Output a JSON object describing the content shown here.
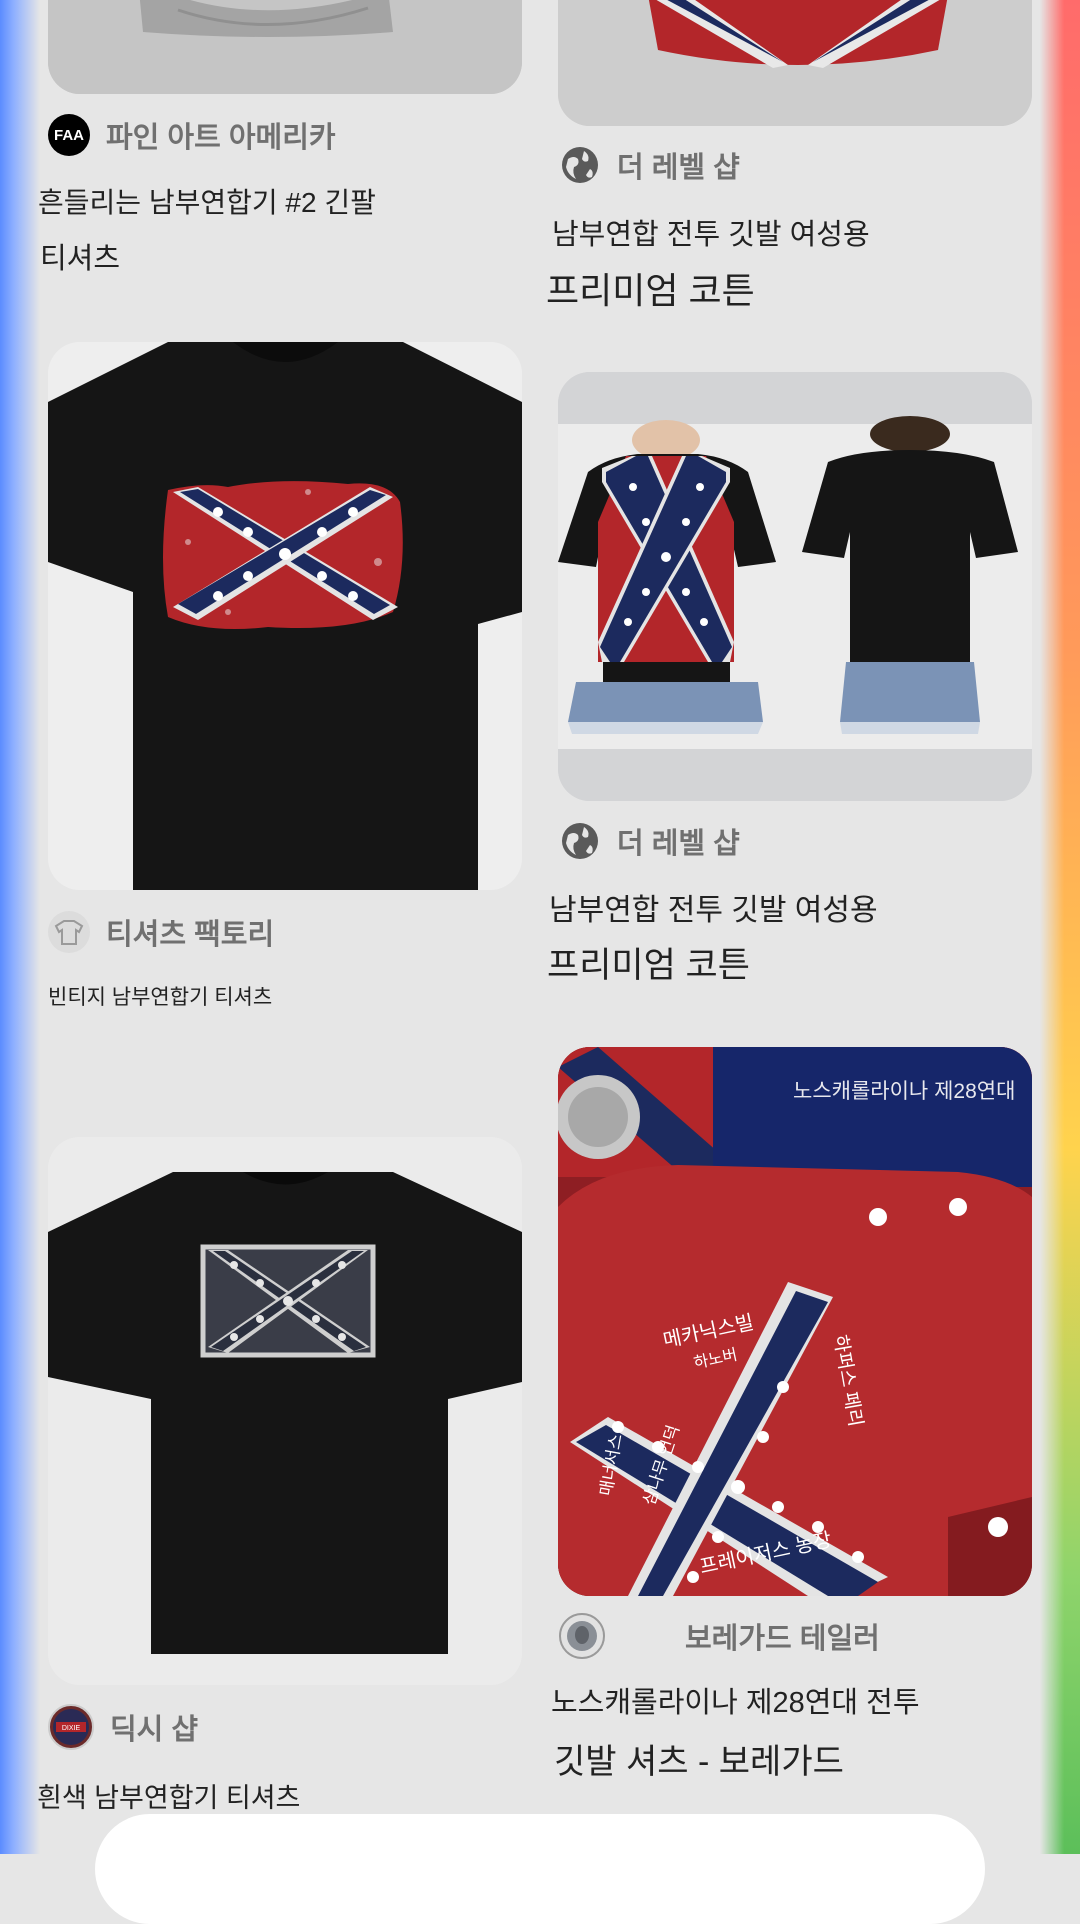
{
  "pins": [
    {
      "source": "파인 아트 아메리카",
      "source_icon": "FAA",
      "title_line1": "흔들리는 남부연합기 #2 긴팔",
      "title_line2": "티셔츠"
    },
    {
      "source": "더 레벨 샵",
      "source_icon": "globe-icon",
      "title_line1": "남부연합 전투 깃발 여성용",
      "title_line2": "프리미엄 코튼"
    },
    {
      "source": "티셔츠 팩토리",
      "source_icon": "tshirt-icon",
      "title_line1": "빈티지 남부연합기 티셔츠",
      "title_line2": ""
    },
    {
      "source": "더 레벨 샵",
      "source_icon": "globe-icon",
      "title_line1": "남부연합 전투 깃발 여성용",
      "title_line2": "프리미엄 코튼"
    },
    {
      "source": "딕시 샵",
      "source_icon": "dixie-shop-logo",
      "title_line1": "흰색 남부연합기 티셔츠",
      "title_line2": ""
    },
    {
      "source": "보레가드 테일러",
      "source_icon": "coin-logo",
      "title_line1": "노스캐롤라이나 제28연대 전투",
      "title_line2": "깃발 셔츠 - 보레가드"
    }
  ],
  "image_texts": {
    "regiment_banner": "노스캐롤라이나 제28연대",
    "shirt_labels": [
      "메카닉스빌",
      "하노버",
      "하퍼스 페리",
      "매너서스",
      "삼나무 언덕",
      "프레이저스 농장"
    ],
    "coin_logo_text": "THE DIXIE SHOP"
  },
  "colors": {
    "accent_blue": "#5b8cff",
    "flag_red": "#b3262a",
    "flag_navy": "#1c2a5e",
    "shirt_black": "#151515"
  }
}
